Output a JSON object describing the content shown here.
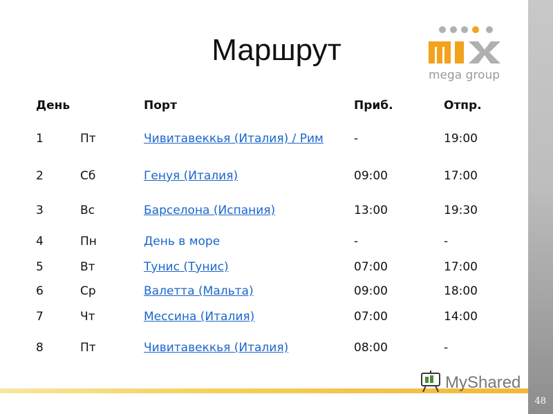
{
  "title": "Маршрут",
  "table": {
    "headers": {
      "day": "День",
      "weekday": "",
      "port": "Порт",
      "arrival": "Приб.",
      "departure": "Отпр."
    },
    "rows": [
      {
        "day": "1",
        "weekday": "Пт",
        "port": "Чивитавеккья (Италия) / Рим",
        "arrival": "-",
        "departure": "19:00"
      },
      {
        "day": "2",
        "weekday": "Сб",
        "port": "Генуя (Италия)",
        "arrival": "09:00",
        "departure": "17:00"
      },
      {
        "day": "3",
        "weekday": "Вс",
        "port": "Барселона (Испания)",
        "arrival": "13:00",
        "departure": "19:30"
      },
      {
        "day": "4",
        "weekday": "Пн",
        "port": "День в море",
        "arrival": "-",
        "departure": "-"
      },
      {
        "day": "5",
        "weekday": "Вт",
        "port": "Тунис (Тунис)",
        "arrival": "07:00",
        "departure": "17:00"
      },
      {
        "day": "6",
        "weekday": "Ср",
        "port": "Валетта (Мальта)",
        "arrival": "09:00",
        "departure": "18:00"
      },
      {
        "day": "7",
        "weekday": "Чт",
        "port": "Мессина (Италия)",
        "arrival": "07:00",
        "departure": "14:00"
      },
      {
        "day": "8",
        "weekday": "Пт",
        "port": "Чивитавеккья (Италия)",
        "arrival": "08:00",
        "departure": "-"
      }
    ]
  },
  "logo": {
    "brand": "mix",
    "tagline": "mega group"
  },
  "page_number": "48",
  "watermark": "MyShared",
  "colors": {
    "link": "#1a66cc",
    "logo_orange": "#f2a21c",
    "logo_gray": "#b0b0b0",
    "stripe": "#f3b73a",
    "watermark_green": "#4a8a3c"
  }
}
